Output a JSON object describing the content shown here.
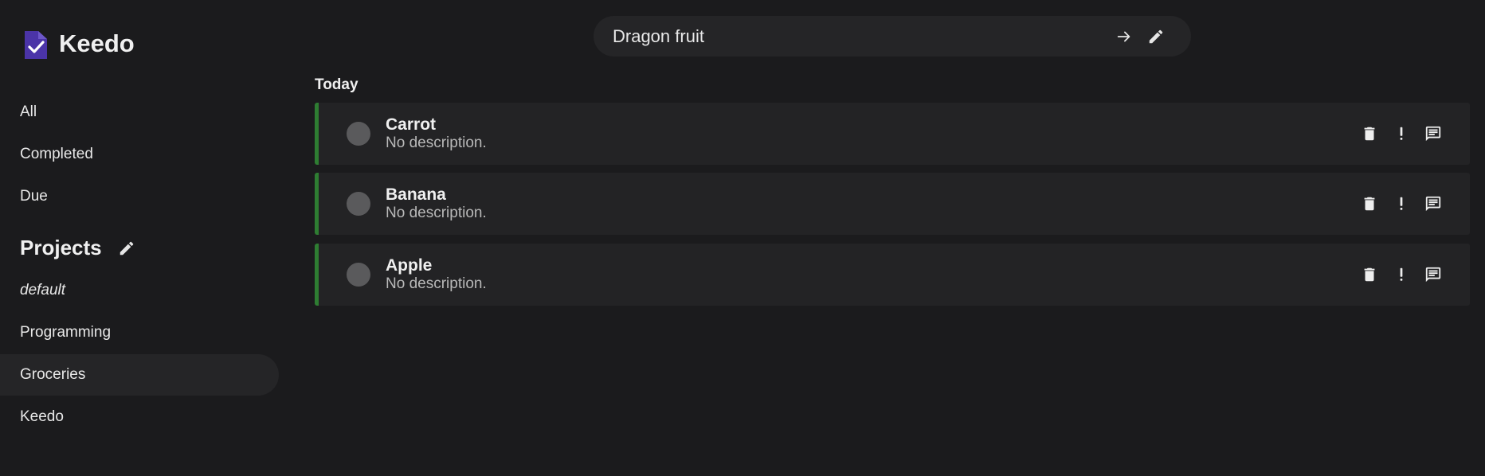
{
  "brand": {
    "name": "Keedo",
    "logo_icon": "clipboard-check-icon",
    "logo_color": "#4b34a8"
  },
  "nav": {
    "items": [
      {
        "label": "All"
      },
      {
        "label": "Completed"
      },
      {
        "label": "Due"
      }
    ]
  },
  "projects": {
    "title": "Projects",
    "edit_icon": "pencil-icon",
    "items": [
      {
        "label": "default"
      },
      {
        "label": "Programming"
      },
      {
        "label": "Groceries"
      },
      {
        "label": "Keedo"
      }
    ],
    "active": "Groceries"
  },
  "new_task": {
    "value": "Dragon fruit",
    "submit_icon": "arrow-right-icon",
    "edit_icon": "pencil-icon"
  },
  "section": {
    "title": "Today"
  },
  "tasks": [
    {
      "title": "Carrot",
      "description": "No description."
    },
    {
      "title": "Banana",
      "description": "No description."
    },
    {
      "title": "Apple",
      "description": "No description."
    }
  ],
  "task_actions": {
    "delete_icon": "trash-icon",
    "priority_icon": "exclamation-icon",
    "comment_icon": "comment-icon"
  },
  "colors": {
    "background": "#1b1b1d",
    "surface": "#232325",
    "accent_bar": "#2e7d32"
  }
}
